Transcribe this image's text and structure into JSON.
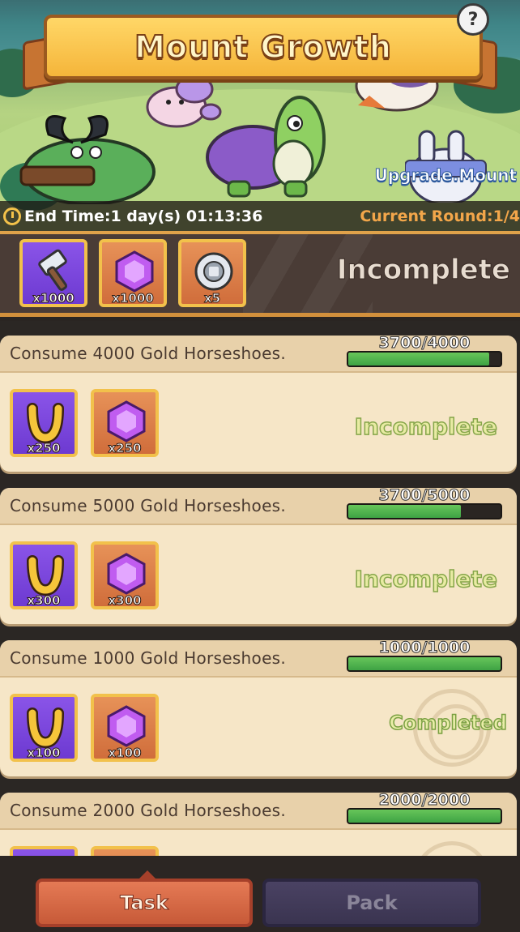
{
  "header": {
    "title": "Mount Growth",
    "help_label": "?",
    "upgrade_link": "Upgrade.Mount",
    "end_time": "End Time:1 day(s) 01:13:36",
    "current_round": "Current Round:1/4"
  },
  "main_reward": {
    "status": "Incomplete",
    "items": [
      {
        "icon": "hammer-icon",
        "qty": "x1000",
        "tile": "purple"
      },
      {
        "icon": "purple-gem-icon",
        "qty": "x1000",
        "tile": "orange"
      },
      {
        "icon": "silver-coin-icon",
        "qty": "x5",
        "tile": "orange"
      }
    ]
  },
  "tasks": [
    {
      "title": "Consume 4000 Gold Horseshoes.",
      "progress_text": "3700/4000",
      "progress": 0.925,
      "status": "Incomplete",
      "rewards": [
        {
          "icon": "gold-horseshoe-icon",
          "qty": "x250"
        },
        {
          "icon": "purple-gem-icon",
          "qty": "x250"
        }
      ]
    },
    {
      "title": "Consume 5000 Gold Horseshoes.",
      "progress_text": "3700/5000",
      "progress": 0.74,
      "status": "Incomplete",
      "rewards": [
        {
          "icon": "gold-horseshoe-icon",
          "qty": "x300"
        },
        {
          "icon": "purple-gem-icon",
          "qty": "x300"
        }
      ]
    },
    {
      "title": "Consume 1000 Gold Horseshoes.",
      "progress_text": "1000/1000",
      "progress": 1.0,
      "status": "Completed",
      "rewards": [
        {
          "icon": "gold-horseshoe-icon",
          "qty": "x100"
        },
        {
          "icon": "purple-gem-icon",
          "qty": "x100"
        }
      ]
    },
    {
      "title": "Consume 2000 Gold Horseshoes.",
      "progress_text": "2000/2000",
      "progress": 1.0,
      "status": "",
      "rewards": []
    }
  ],
  "tabs": {
    "task_label": "Task",
    "pack_label": "Pack"
  },
  "colors": {
    "title_gold": "#f5b53a",
    "progress_green": "#3ea344",
    "card_bg": "#f6e6c7",
    "purple_tile": "#6d3ad1",
    "orange_tile": "#d06d3b"
  }
}
